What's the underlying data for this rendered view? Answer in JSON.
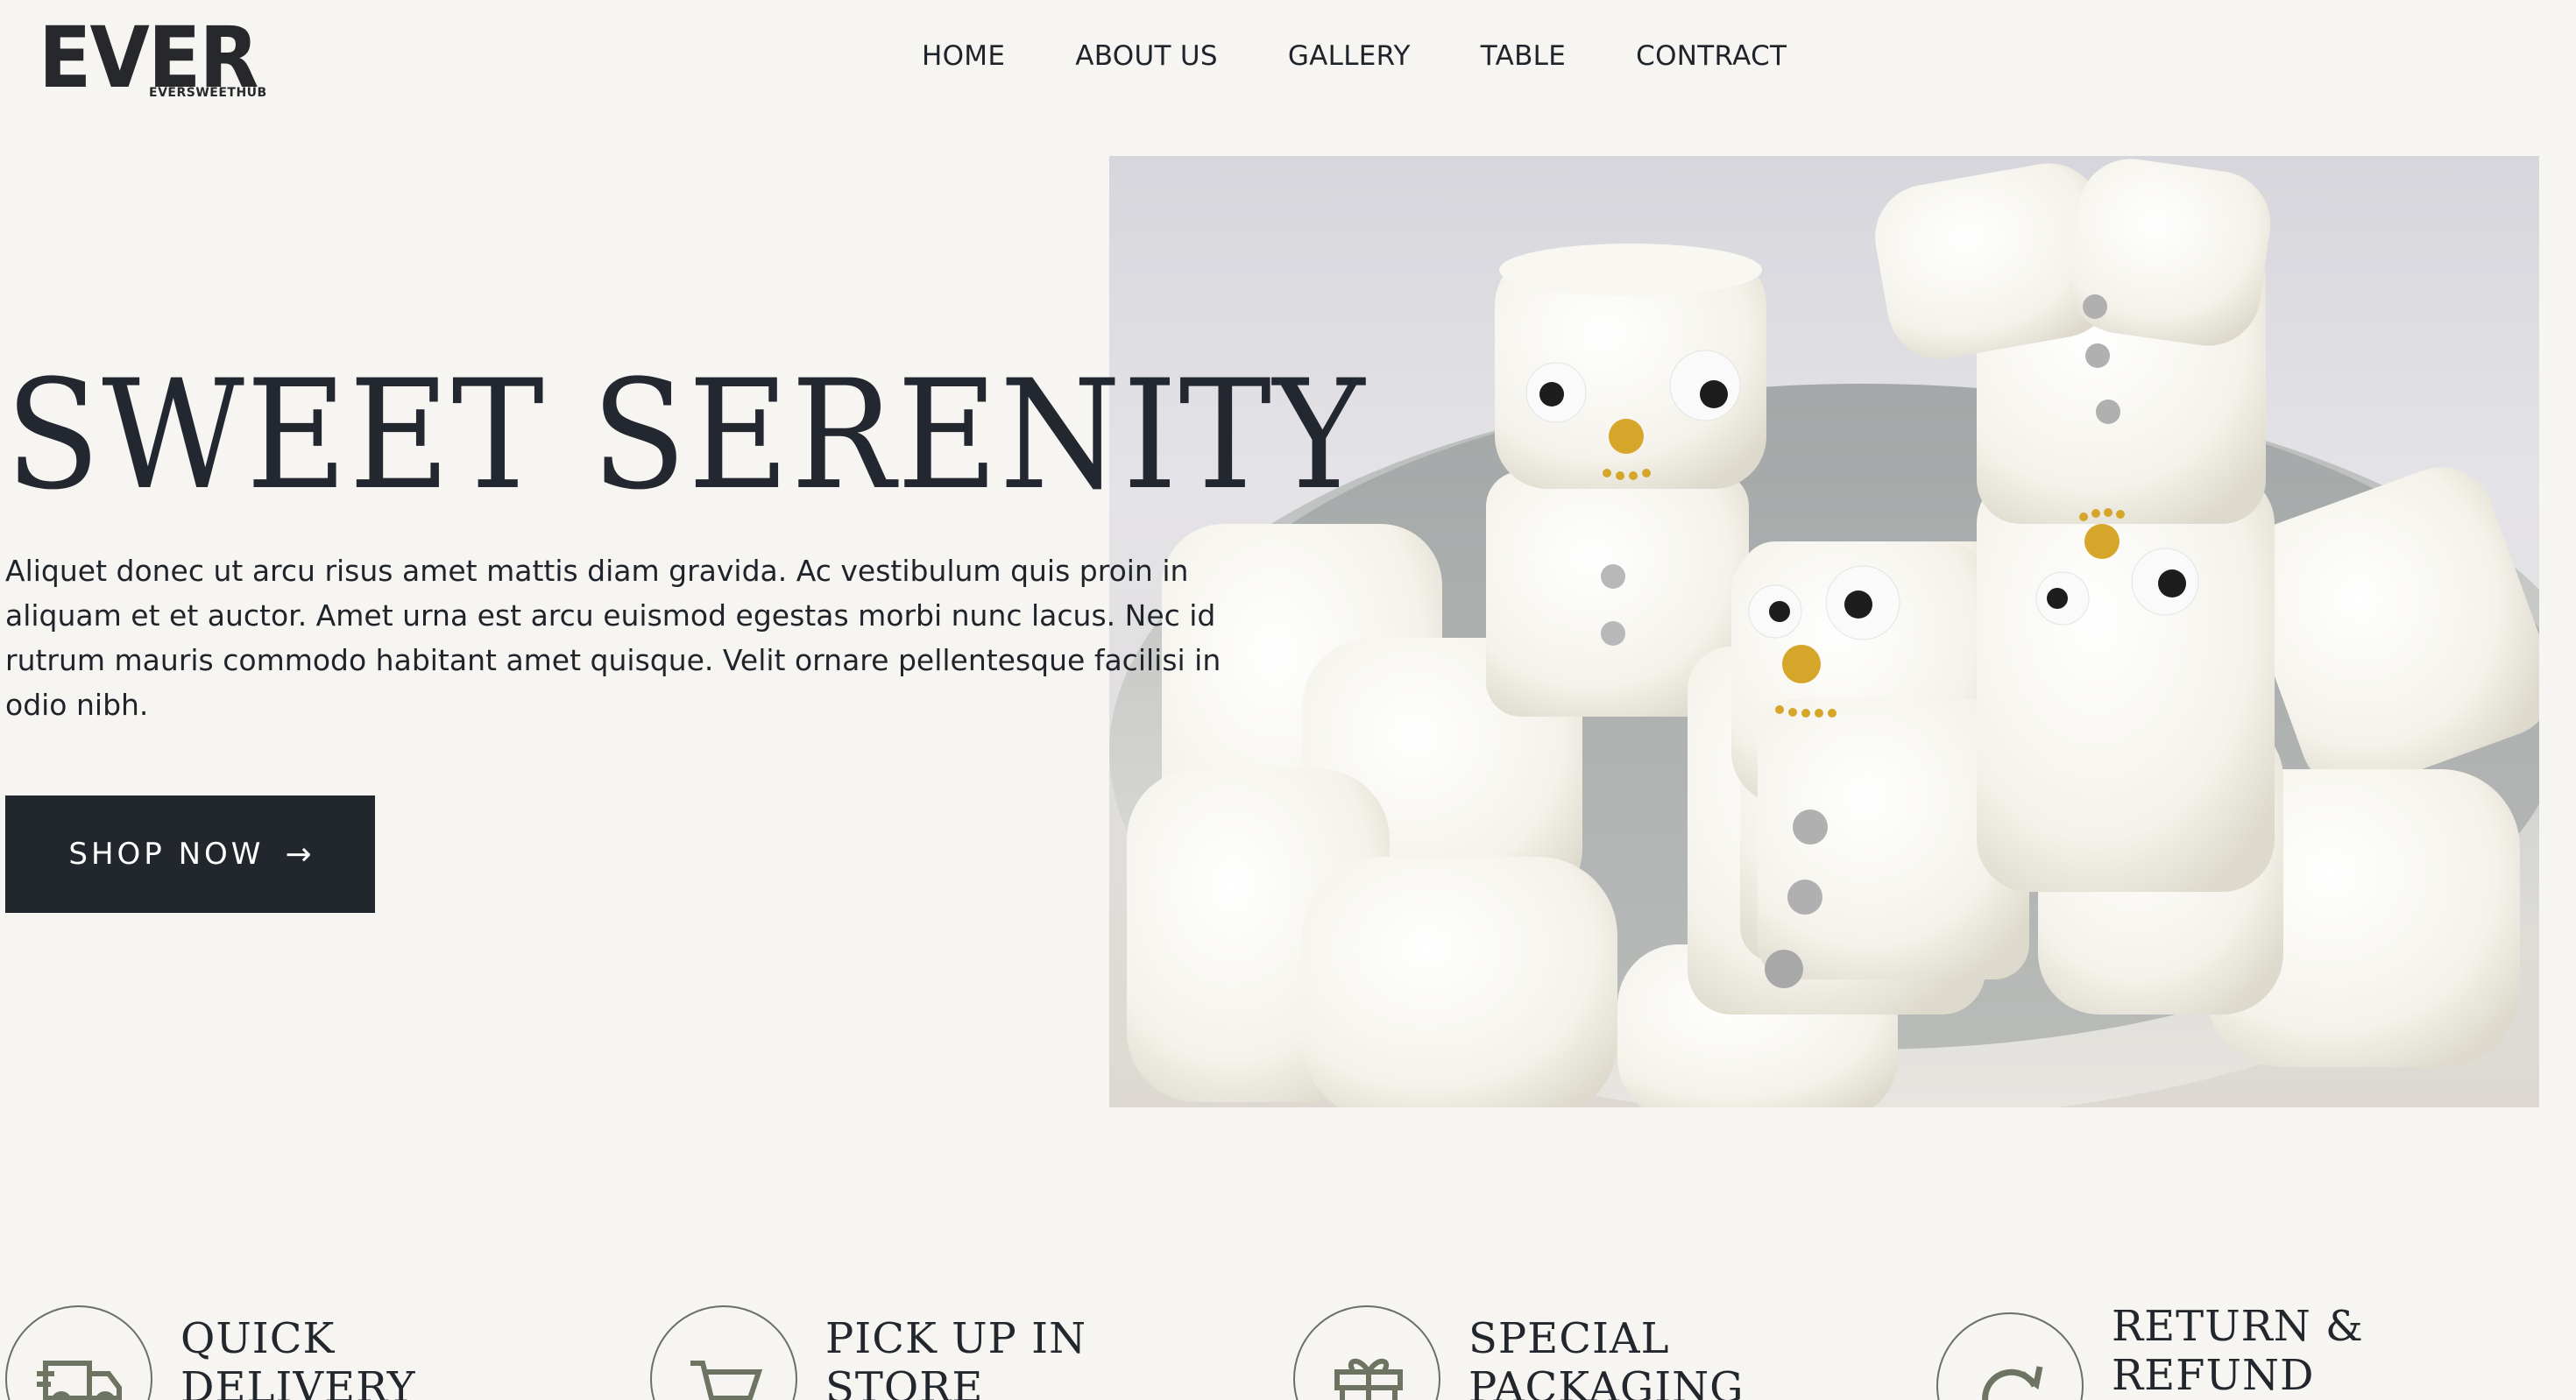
{
  "header": {
    "logo_text": "EVER",
    "logo_subtext": "EVERSWEETHUB",
    "nav": [
      "HOME",
      "ABOUT US",
      "GALLERY",
      "TABLE",
      "CONTRACT"
    ]
  },
  "hero": {
    "title": "SWEET SERENITY",
    "description": "Aliquet donec ut arcu risus amet mattis diam gravida. Ac vestibulum quis proin in aliquam et et auctor. Amet urna est arcu euismod egestas morbi nunc lacus. Nec id rutrum mauris commodo habitant amet quisque. Velit ornare pellentesque facilisi in odio nibh.",
    "button_label": "SHOP NOW",
    "button_arrow": "→",
    "image_icon": "marshmallow-snowmen-photo"
  },
  "features": [
    {
      "title": "QUICK DELIVERY",
      "icon": "truck-icon"
    },
    {
      "title": "PICK UP IN STORE",
      "icon": "cart-icon"
    },
    {
      "title": "SPECIAL PACKAGING",
      "icon": "gift-icon"
    },
    {
      "title": "RETURN & REFUND",
      "icon": "refresh-icon"
    }
  ],
  "colors": {
    "background": "#f6f5f2",
    "dark": "#22262d",
    "icon": "#6d7461"
  }
}
